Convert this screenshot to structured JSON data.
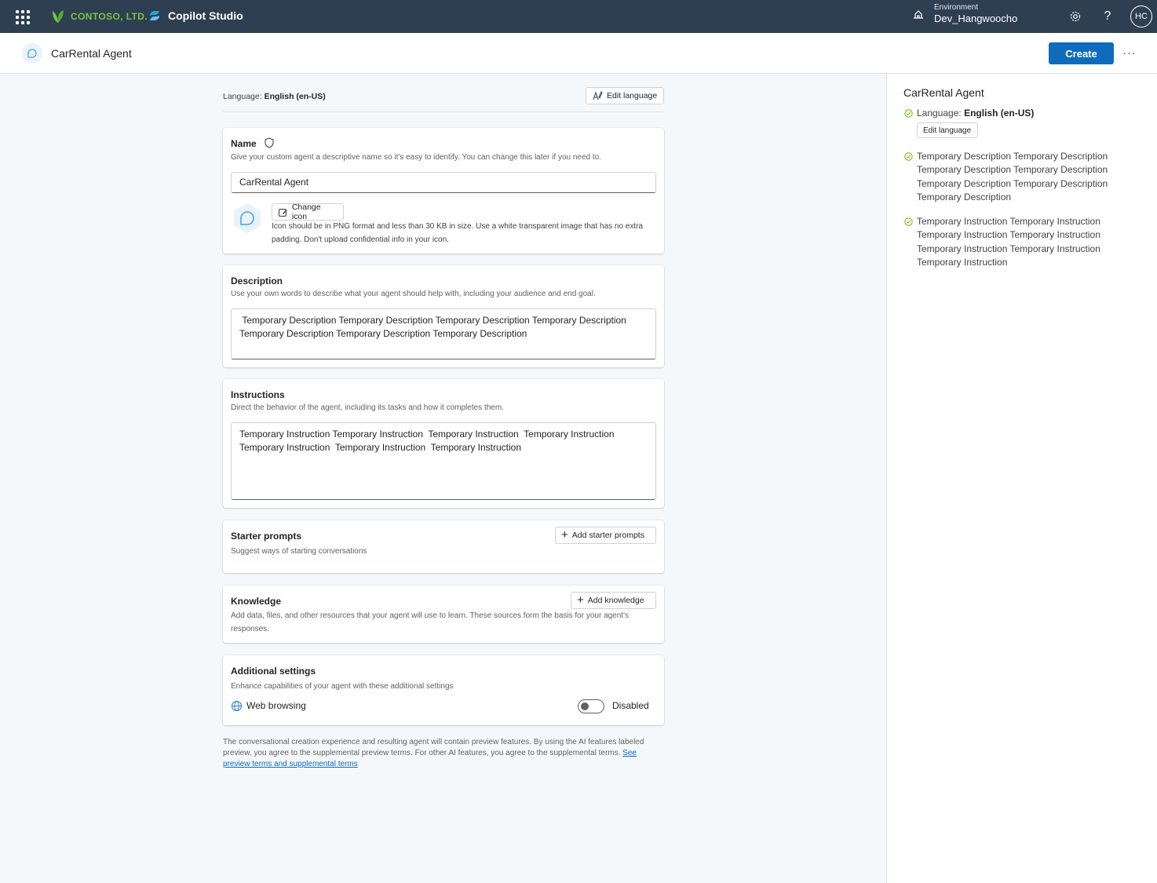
{
  "topbar": {
    "company": "CONTOSO, LTD.",
    "product": "Copilot Studio",
    "environment_label": "Environment",
    "environment_value": "Dev_Hangwoocho",
    "avatar_initials": "HC",
    "background_color": "#2f3f52"
  },
  "header": {
    "agent_name": "CarRental Agent",
    "create_label": "Create",
    "more_label": "···"
  },
  "language_row": {
    "label": "Language:",
    "value": "English (en-US)",
    "edit_label": "Edit language"
  },
  "name_card": {
    "title": "Name",
    "subtitle": "Give your custom agent a descriptive name so it's easy to identify. You can change this later if you need to.",
    "value": "CarRental Agent",
    "change_icon_label": "Change icon",
    "icon_help": "Icon should be in PNG format and less than 30 KB in size. Use a white transparent image that has no extra padding. Don't upload confidential info in your icon."
  },
  "description_card": {
    "title": "Description",
    "subtitle": "Use your own words to describe what your agent should help with, including your audience and end goal.",
    "value": " Temporary Description Temporary Description Temporary Description Temporary Description Temporary Description Temporary Description Temporary Description"
  },
  "instructions_card": {
    "title": "Instructions",
    "subtitle": "Direct the behavior of the agent, including its tasks and how it completes them.",
    "value": "Temporary Instruction Temporary Instruction  Temporary Instruction  Temporary Instruction Temporary Instruction  Temporary Instruction  Temporary Instruction"
  },
  "starter_card": {
    "title": "Starter prompts",
    "subtitle": "Suggest ways of starting conversations",
    "button": "Add starter prompts"
  },
  "knowledge_card": {
    "title": "Knowledge",
    "subtitle": "Add data, files, and other resources that your agent will use to learn. These sources form the basis for your agent's responses.",
    "button": "Add knowledge"
  },
  "settings_card": {
    "title": "Additional settings",
    "subtitle": "Enhance capabilities of your agent with these additional settings",
    "web_browsing_label": "Web browsing",
    "web_browsing_status": "Disabled"
  },
  "footer": {
    "text": "The conversational creation experience and resulting agent will contain preview features. By using the AI features labeled preview, you agree to the supplemental preview terms. For other AI features, you agree to the supplemental terms. ",
    "link": "See preview terms and supplemental terms"
  },
  "right_panel": {
    "title": "CarRental Agent",
    "language_label": "Language:",
    "language_value": "English (en-US)",
    "edit_language": "Edit language",
    "description": "Temporary Description Temporary Description Temporary Description Temporary Description Temporary Description Temporary Description Temporary Description",
    "instructions": "Temporary Instruction Temporary Instruction Temporary Instruction Temporary Instruction Temporary Instruction Temporary Instruction Temporary Instruction"
  },
  "colors": {
    "accent": "#0f6cbd",
    "brand_green": "#76c442",
    "check_green": "#6bb700"
  },
  "icons": [
    "app-launcher-icon",
    "contoso-leaf-icon",
    "copilot-studio-icon",
    "environment-icon",
    "settings-gear-icon",
    "help-icon",
    "agent-icon",
    "edit-language-icon",
    "shield-icon",
    "change-icon-icon",
    "add-icon",
    "globe-icon",
    "check-circle-icon"
  ]
}
